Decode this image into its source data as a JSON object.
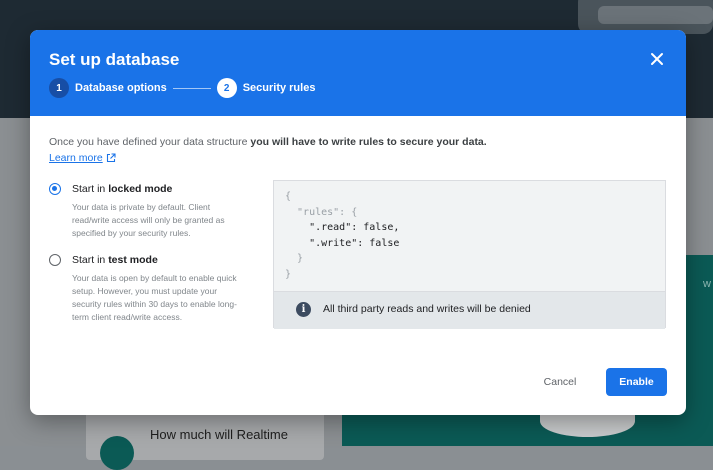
{
  "background": {
    "card_text": "How much will Realtime",
    "side_letter": "w"
  },
  "dialog": {
    "title": "Set up database",
    "close_icon": "close-icon",
    "steps": [
      {
        "number": "1",
        "label": "Database options",
        "state": "done"
      },
      {
        "number": "2",
        "label": "Security rules",
        "state": "active"
      }
    ],
    "intro_text": "Once you have defined your data structure ",
    "intro_bold": "you will have to write rules to secure your data.",
    "learn_more": "Learn more",
    "options": [
      {
        "prefix": "Start in ",
        "mode": "locked mode",
        "description": "Your data is private by default. Client read/write access will only be granted as specified by your security rules.",
        "selected": true
      },
      {
        "prefix": "Start in ",
        "mode": "test mode",
        "description": "Your data is open by default to enable quick setup. However, you must update your security rules within 30 days to enable long-term client read/write access.",
        "selected": false
      }
    ],
    "code_lines": [
      "{",
      "  \"rules\": {",
      "    \".read\": false,",
      "    \".write\": false",
      "  }",
      "}"
    ],
    "info_text": "All third party reads and writes will be denied",
    "cancel_label": "Cancel",
    "enable_label": "Enable"
  },
  "colors": {
    "accent": "#1a73e8",
    "header_bg": "#1a73e8",
    "code_bg": "#f1f3f4"
  }
}
